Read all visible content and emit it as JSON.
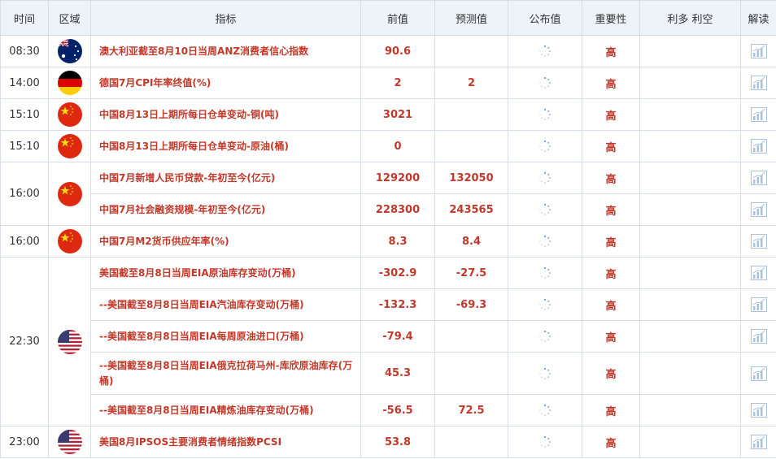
{
  "headers": {
    "time": "时间",
    "region": "区域",
    "indicator": "指标",
    "previous": "前值",
    "forecast": "预测值",
    "actual": "公布值",
    "importance": "重要性",
    "impact": "利多 利空",
    "analysis": "解读"
  },
  "rows": [
    {
      "time": "08:30",
      "flag": "australia-flag",
      "indicator": "澳大利亚截至8月10日当周ANZ消费者信心指数",
      "previous": "90.6",
      "forecast": "",
      "importance": "高"
    },
    {
      "time": "14:00",
      "flag": "germany-flag",
      "indicator": "德国7月CPI年率终值(%)",
      "previous": "2",
      "forecast": "2",
      "importance": "高"
    },
    {
      "time": "15:10",
      "flag": "china-flag",
      "indicator": "中国8月13日上期所每日仓单变动-铜(吨)",
      "previous": "3021",
      "forecast": "",
      "importance": "高"
    },
    {
      "time": "15:10",
      "flag": "china-flag",
      "indicator": "中国8月13日上期所每日仓单变动-原油(桶)",
      "previous": "0",
      "forecast": "",
      "importance": "高"
    },
    {
      "time": "16:00",
      "flag": "china-flag",
      "indicator": "中国7月新增人民币贷款-年初至今(亿元)",
      "previous": "129200",
      "forecast": "132050",
      "importance": "高"
    },
    {
      "time": "",
      "flag": "",
      "indicator": "中国7月社会融资规模-年初至今(亿元)",
      "previous": "228300",
      "forecast": "243565",
      "importance": "高"
    },
    {
      "time": "16:00",
      "flag": "china-flag",
      "indicator": "中国7月M2货币供应年率(%)",
      "previous": "8.3",
      "forecast": "8.4",
      "importance": "高"
    },
    {
      "time": "22:30",
      "flag": "usa-flag",
      "indicator": "美国截至8月8日当周EIA原油库存变动(万桶)",
      "previous": "-302.9",
      "forecast": "-27.5",
      "importance": "高"
    },
    {
      "time": "",
      "flag": "",
      "indicator": "--美国截至8月8日当周EIA汽油库存变动(万桶)",
      "previous": "-132.3",
      "forecast": "-69.3",
      "importance": "高"
    },
    {
      "time": "",
      "flag": "",
      "indicator": "--美国截至8月8日当周EIA每周原油进口(万桶)",
      "previous": "-79.4",
      "forecast": "",
      "importance": "高"
    },
    {
      "time": "",
      "flag": "",
      "indicator": "--美国截至8月8日当周EIA俄克拉荷马州-库欣原油库存(万桶)",
      "previous": "45.3",
      "forecast": "",
      "importance": "高"
    },
    {
      "time": "",
      "flag": "",
      "indicator": "--美国截至8月8日当周EIA精炼油库存变动(万桶)",
      "previous": "-56.5",
      "forecast": "72.5",
      "importance": "高"
    },
    {
      "time": "23:00",
      "flag": "usa-flag",
      "indicator": "美国8月IPSOS主要消费者情绪指数PCSI",
      "previous": "53.8",
      "forecast": "",
      "importance": "高"
    }
  ]
}
